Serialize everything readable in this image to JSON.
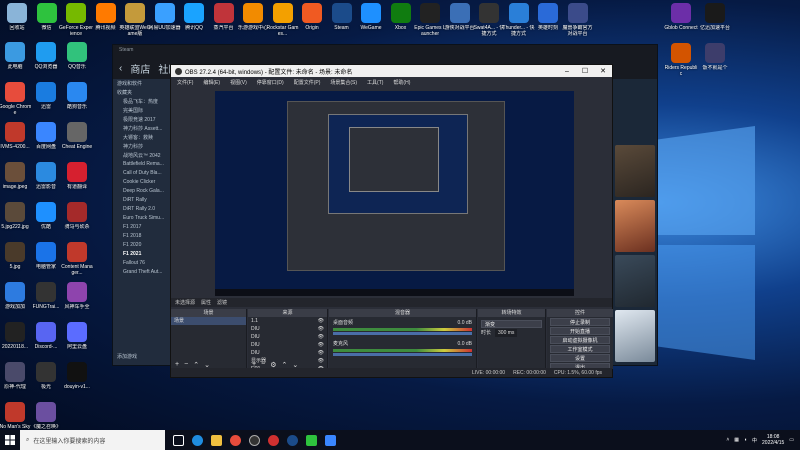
{
  "desktop_icons_left": [
    {
      "label": "回收站",
      "color": "#8ab4d8",
      "icon": "recycle-bin-icon"
    },
    {
      "label": "微信",
      "color": "#2ec23e",
      "icon": "wechat-icon"
    },
    {
      "label": "GeForce Experience",
      "color": "#76b900",
      "icon": "geforce-icon"
    },
    {
      "label": "腾讯视频",
      "color": "#ff7a00",
      "icon": "tencent-video-icon"
    },
    {
      "label": "英雄联盟WeGame版",
      "color": "#c49a3b",
      "icon": "lol-icon"
    },
    {
      "label": "网易UU加速器",
      "color": "#3aa0ff",
      "icon": "uu-icon"
    },
    {
      "label": "腾讯QQ",
      "color": "#1aa3ff",
      "icon": "qq-icon"
    },
    {
      "label": "蒸汽平台",
      "color": "#c0343a",
      "icon": "steam-cn-icon"
    },
    {
      "label": "乐游游戏中心",
      "color": "#f28b00",
      "icon": "game-center-icon"
    },
    {
      "label": "Rockstar Games...",
      "color": "#f3a000",
      "icon": "rockstar-icon"
    },
    {
      "label": "Origin",
      "color": "#f05a22",
      "icon": "origin-icon"
    },
    {
      "label": "Steam",
      "color": "#1b4b8a",
      "icon": "steam-icon"
    },
    {
      "label": "WeGame",
      "color": "#1e90ff",
      "icon": "wegame-icon"
    },
    {
      "label": "Xbox",
      "color": "#107c10",
      "icon": "xbox-icon"
    },
    {
      "label": "Epic Games Launcher",
      "color": "#222222",
      "icon": "epic-icon"
    },
    {
      "label": "游侠对战平台",
      "color": "#3b6fb6",
      "icon": "youxia-icon"
    },
    {
      "label": "Swat4A... - 快捷方式",
      "color": "#333333",
      "icon": "swat-icon"
    },
    {
      "label": "Thunder... - 快捷方式",
      "color": "#2a7fd8",
      "icon": "thunder-icon"
    },
    {
      "label": "英雄时刻",
      "color": "#2a6ad8",
      "icon": "hero-icon"
    },
    {
      "label": "魔兽争霸官方对战平台",
      "color": "#3b4b8a",
      "icon": "warcraft-icon"
    }
  ],
  "desktop_icons_side": [
    {
      "label": "此电脑",
      "color": "#3b9ae1",
      "icon": "computer-icon"
    },
    {
      "label": "QQ浏览器",
      "color": "#1f9cf0",
      "icon": "qq-browser-icon"
    },
    {
      "label": "QQ音乐",
      "color": "#31c27c",
      "icon": "qq-music-icon"
    },
    {
      "label": "Google Chrome",
      "color": "#e74c3c",
      "icon": "chrome-icon"
    },
    {
      "label": "迅雷",
      "color": "#1a7ce0",
      "icon": "xunlei-icon"
    },
    {
      "label": "酷狗音乐",
      "color": "#2a88f0",
      "icon": "kugou-icon"
    },
    {
      "label": "IVMS-4200...",
      "color": "#c0392b",
      "icon": "ivms-icon"
    },
    {
      "label": "百度网盘",
      "color": "#3a86ff",
      "icon": "baidu-icon"
    },
    {
      "label": "Cheat Engine",
      "color": "#666666",
      "icon": "cheat-engine-icon"
    },
    {
      "label": "image.jpeg",
      "color": "#6b4f3a",
      "icon": "image-file-icon"
    },
    {
      "label": "迅雷影音",
      "color": "#2b8ae0",
      "icon": "xunlei-player-icon"
    },
    {
      "label": "有道翻译",
      "color": "#d6202f",
      "icon": "youdao-icon"
    },
    {
      "label": "5.jpg222.jpg",
      "color": "#5b4a3a",
      "icon": "image-file-icon"
    },
    {
      "label": "优酷",
      "color": "#1e90ff",
      "icon": "youku-icon"
    },
    {
      "label": "骑马与砍杀",
      "color": "#a52a2a",
      "icon": "mount-blade-icon"
    },
    {
      "label": "5.jpg",
      "color": "#4a3a2a",
      "icon": "image-file-icon"
    },
    {
      "label": "电脑管家",
      "color": "#1a73e8",
      "icon": "pc-manager-icon"
    },
    {
      "label": "Content Manager...",
      "color": "#c0392b",
      "icon": "content-manager-icon"
    },
    {
      "label": "游戏加加",
      "color": "#2d7be0",
      "icon": "game-plus-icon"
    },
    {
      "label": "FUNGTrai...",
      "color": "#333333",
      "icon": "fungtrainer-icon"
    },
    {
      "label": "风神车手全",
      "color": "#8e44ad",
      "icon": "racer-icon"
    },
    {
      "label": "20220118...",
      "color": "#222222",
      "icon": "file-icon"
    },
    {
      "label": "Discord-...",
      "color": "#5865f2",
      "icon": "discord-icon"
    },
    {
      "label": "阿里云盘",
      "color": "#5b6cff",
      "icon": "aliyun-icon"
    },
    {
      "label": "原神-代理",
      "color": "#4a4a6a",
      "icon": "genshin-icon"
    },
    {
      "label": "极光",
      "color": "#333333",
      "icon": "aurora-icon"
    },
    {
      "label": "douyin-v1...",
      "color": "#111111",
      "icon": "douyin-icon"
    },
    {
      "label": "No Man's Sky",
      "color": "#c0392b",
      "icon": "nms-icon"
    },
    {
      "label": "《魔之召唤》 Catalyst",
      "color": "#6b4fa0",
      "icon": "catalyst-icon"
    }
  ],
  "desktop_icons_right": [
    {
      "label": "Gblob Connect",
      "color": "#6c2ea8",
      "icon": "gblob-icon"
    },
    {
      "label": "亿迅加速平台",
      "color": "#1a1a1a",
      "icon": "yixun-icon"
    },
    {
      "label": "Riders Republic",
      "color": "#d35400",
      "icon": "riders-icon"
    },
    {
      "label": "饭不就是个",
      "color": "#3d3d6b",
      "icon": "app-icon"
    }
  ],
  "steam": {
    "nav_store": "商店",
    "nav_community": "社区",
    "library_title": "游戏和软件",
    "collection_header": "收藏夹",
    "games": [
      "极品飞车：热度",
      "完美国际",
      "极限竞速 2017",
      "神力科莎 Assett...",
      "大镖客：救赎",
      "神力科莎",
      "战地风云™ 2042",
      "Battlefield Rema...",
      "Call of Duty Bla...",
      "Cookie Clicker",
      "Deep Rock Gala...",
      "DiRT Rally",
      "DiRT Rally 2.0",
      "Euro Truck Simu...",
      "F1 2017",
      "F1 2018",
      "F1 2020",
      "F1 2021",
      "Fallout 76",
      "Grand Theft Aut..."
    ],
    "active_game_index": 17,
    "add_game": "添加游戏"
  },
  "obs": {
    "title": "OBS 27.2.4 (64-bit, windows) - 配置文件: 未命名 - 场景: 未命名",
    "menu": [
      "文件(F)",
      "编辑(E)",
      "视图(V)",
      "停靠窗口(D)",
      "配置文件(P)",
      "场景集合(S)",
      "工具(T)",
      "帮助(H)"
    ],
    "source_status": "未选择源",
    "status_items": [
      "属性",
      "滤镜"
    ],
    "scenes_header": "场景",
    "scenes": [
      "场景"
    ],
    "sources_header": "来源",
    "sources": [
      "1.1",
      "DIU",
      "DIU",
      "DIU",
      "DIU",
      "显示器",
      "EP1"
    ],
    "mixer_header": "混音器",
    "mixer_channels": [
      {
        "name": "桌面音频",
        "level": "0.0 dB"
      },
      {
        "name": "麦克风",
        "level": "0.0 dB"
      }
    ],
    "transitions_header": "转场特效",
    "transition_type": "渐变",
    "duration_label": "时长",
    "duration_value": "300 ms",
    "controls_header": "控件",
    "controls": [
      "停止录制",
      "开始直播",
      "启动虚拟摄像机",
      "工作室模式",
      "设置",
      "退出"
    ],
    "footer": [
      "LIVE: 00:00:00",
      "REC: 00:00:00",
      "CPU: 1.5%, 60.00 fps"
    ]
  },
  "taskbar": {
    "search_placeholder": "在这里输入你要搜索的内容",
    "time": "18:08",
    "date": "2022/4/15"
  }
}
